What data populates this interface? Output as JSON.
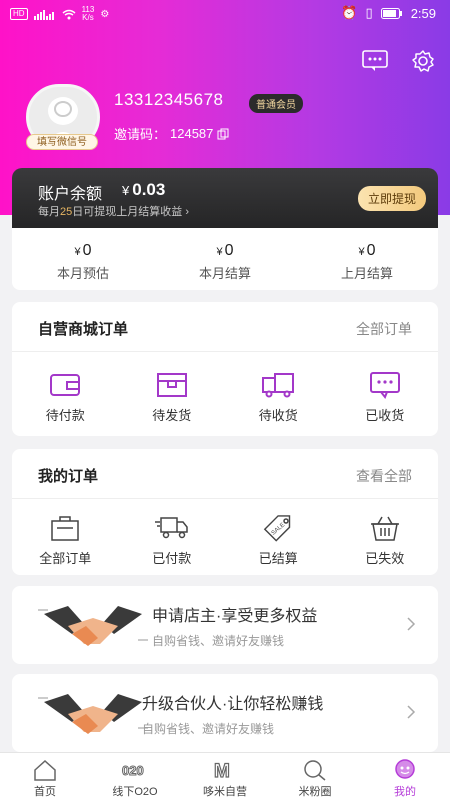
{
  "status_bar": {
    "left_badge": "HD",
    "net_speed_value": "113",
    "net_speed_unit": "K/s",
    "time": "2:59"
  },
  "profile": {
    "phone": "13312345678",
    "member_level": "普通会员",
    "wechat_badge": "填写微信号",
    "invite_label": "邀请码：",
    "invite_code": "124587"
  },
  "balance": {
    "title": "账户余额",
    "currency": "¥",
    "amount": "0.03",
    "note_prefix": "每月",
    "note_day": "25",
    "note_suffix": "日可提现上月结算收益",
    "withdraw_label": "立即提现"
  },
  "stats": [
    {
      "currency": "¥",
      "value": "0",
      "label": "本月预估"
    },
    {
      "currency": "¥",
      "value": "0",
      "label": "本月结算"
    },
    {
      "currency": "¥",
      "value": "0",
      "label": "上月结算"
    }
  ],
  "mall_orders": {
    "title": "自营商城订单",
    "more": "全部订单",
    "items": [
      {
        "label": "待付款",
        "icon": "wallet-icon"
      },
      {
        "label": "待发货",
        "icon": "box-icon"
      },
      {
        "label": "待收货",
        "icon": "truck-icon"
      },
      {
        "label": "已收货",
        "icon": "chat-icon"
      }
    ]
  },
  "my_orders": {
    "title": "我的订单",
    "more": "查看全部",
    "items": [
      {
        "label": "全部订单",
        "icon": "bag-icon"
      },
      {
        "label": "已付款",
        "icon": "delivery-icon"
      },
      {
        "label": "已结算",
        "icon": "sale-tag-icon"
      },
      {
        "label": "已失效",
        "icon": "basket-icon"
      }
    ]
  },
  "promos": [
    {
      "title": "申请店主·享受更多权益",
      "subtitle": "自购省钱、邀请好友赚钱"
    },
    {
      "title": "升级合伙人·让你轻松赚钱",
      "subtitle": "自购省钱、邀请好友赚钱"
    }
  ],
  "tabs": [
    {
      "label": "首页",
      "icon": "home-icon"
    },
    {
      "label": "线下O2O",
      "icon": "o2o-icon"
    },
    {
      "label": "哆米自营",
      "icon": "m-logo-icon"
    },
    {
      "label": "米粉圈",
      "icon": "search-circle-icon"
    },
    {
      "label": "我的",
      "icon": "profile-icon",
      "active": true
    }
  ],
  "colors": {
    "accent": "#b53dd8",
    "header_start": "#ff12c8",
    "header_end": "#8a3be6",
    "gold": "#e5b563"
  }
}
